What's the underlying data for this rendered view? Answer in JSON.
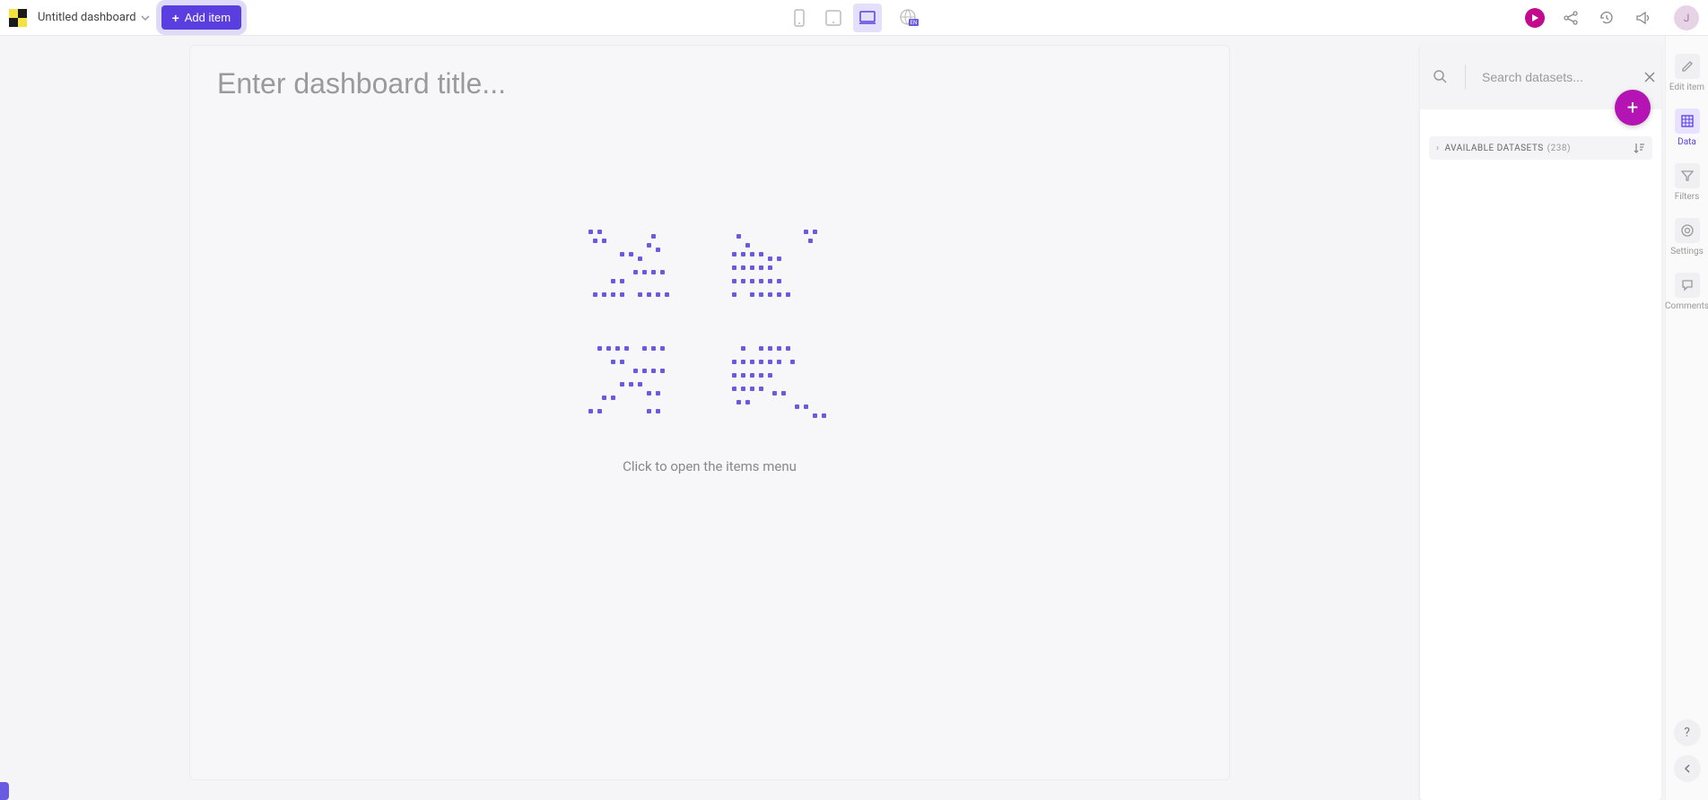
{
  "topbar": {
    "dashboard_name": "Untitled dashboard",
    "add_item_label": "Add item",
    "lang_badge": "EN",
    "avatar_initial": "J"
  },
  "canvas": {
    "title_placeholder": "Enter dashboard title...",
    "hint": "Click to open the items menu"
  },
  "data_panel": {
    "search_placeholder": "Search datasets...",
    "section_label": "AVAILABLE DATASETS",
    "section_count": "(238)"
  },
  "right_rail": {
    "items": [
      {
        "label": "Edit item"
      },
      {
        "label": "Data"
      },
      {
        "label": "Filters"
      },
      {
        "label": "Settings"
      },
      {
        "label": "Comments"
      }
    ],
    "help": "?"
  }
}
